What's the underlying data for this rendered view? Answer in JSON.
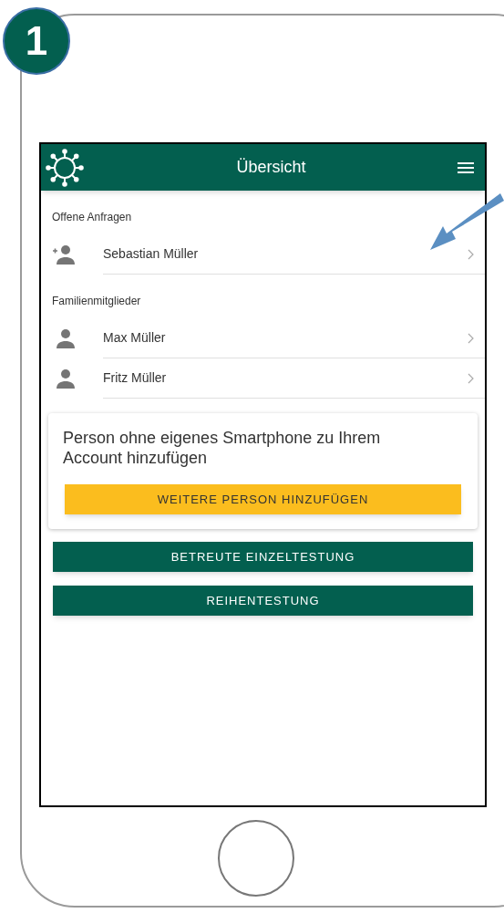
{
  "step_badge": "1",
  "header": {
    "title": "Übersicht"
  },
  "sections": [
    {
      "title": "Offene Anfragen",
      "items": [
        {
          "name": "Sebastian Müller",
          "kind": "request"
        }
      ]
    },
    {
      "title": "Familienmitglieder",
      "items": [
        {
          "name": "Max Müller",
          "kind": "member"
        },
        {
          "name": "Fritz Müller",
          "kind": "member"
        }
      ]
    }
  ],
  "card": {
    "text": "Person ohne eigenes Smartphone zu Ihrem Account hinzufügen",
    "button": "WEITERE PERSON HINZUFÜGEN"
  },
  "buttons": [
    "BETREUTE EINZELTESTUNG",
    "REIHENTESTUNG"
  ]
}
